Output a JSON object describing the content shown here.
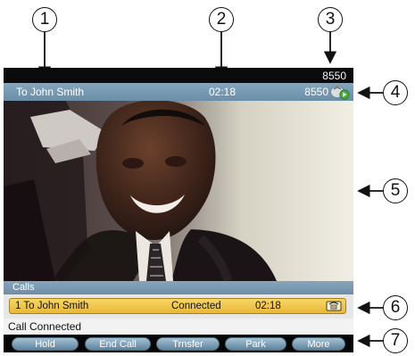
{
  "callouts": {
    "c1": "1",
    "c2": "2",
    "c3": "3",
    "c4": "4",
    "c5": "5",
    "c6": "6",
    "c7": "7"
  },
  "top_strip": {
    "extension": "8550"
  },
  "header": {
    "calling_party": "To John Smith",
    "call_timer": "02:18",
    "extension": "8550",
    "video_icon": "video-call-icon"
  },
  "video": {
    "description_icon": "live-video-feed"
  },
  "calls": {
    "section_label": "Calls",
    "rows": [
      {
        "party": "1 To John Smith",
        "state": "Connected",
        "duration": "02:18",
        "icon": "phone-icon"
      }
    ]
  },
  "status": {
    "message": "Call Connected"
  },
  "softkeys": [
    "Hold",
    "End Call",
    "Trnsfer",
    "Park",
    "More"
  ],
  "colors": {
    "header_blue": "#7597b1",
    "active_call_yellow": "#f0c94d",
    "softkey_blue": "#7d9db3",
    "background_black": "#000000"
  }
}
